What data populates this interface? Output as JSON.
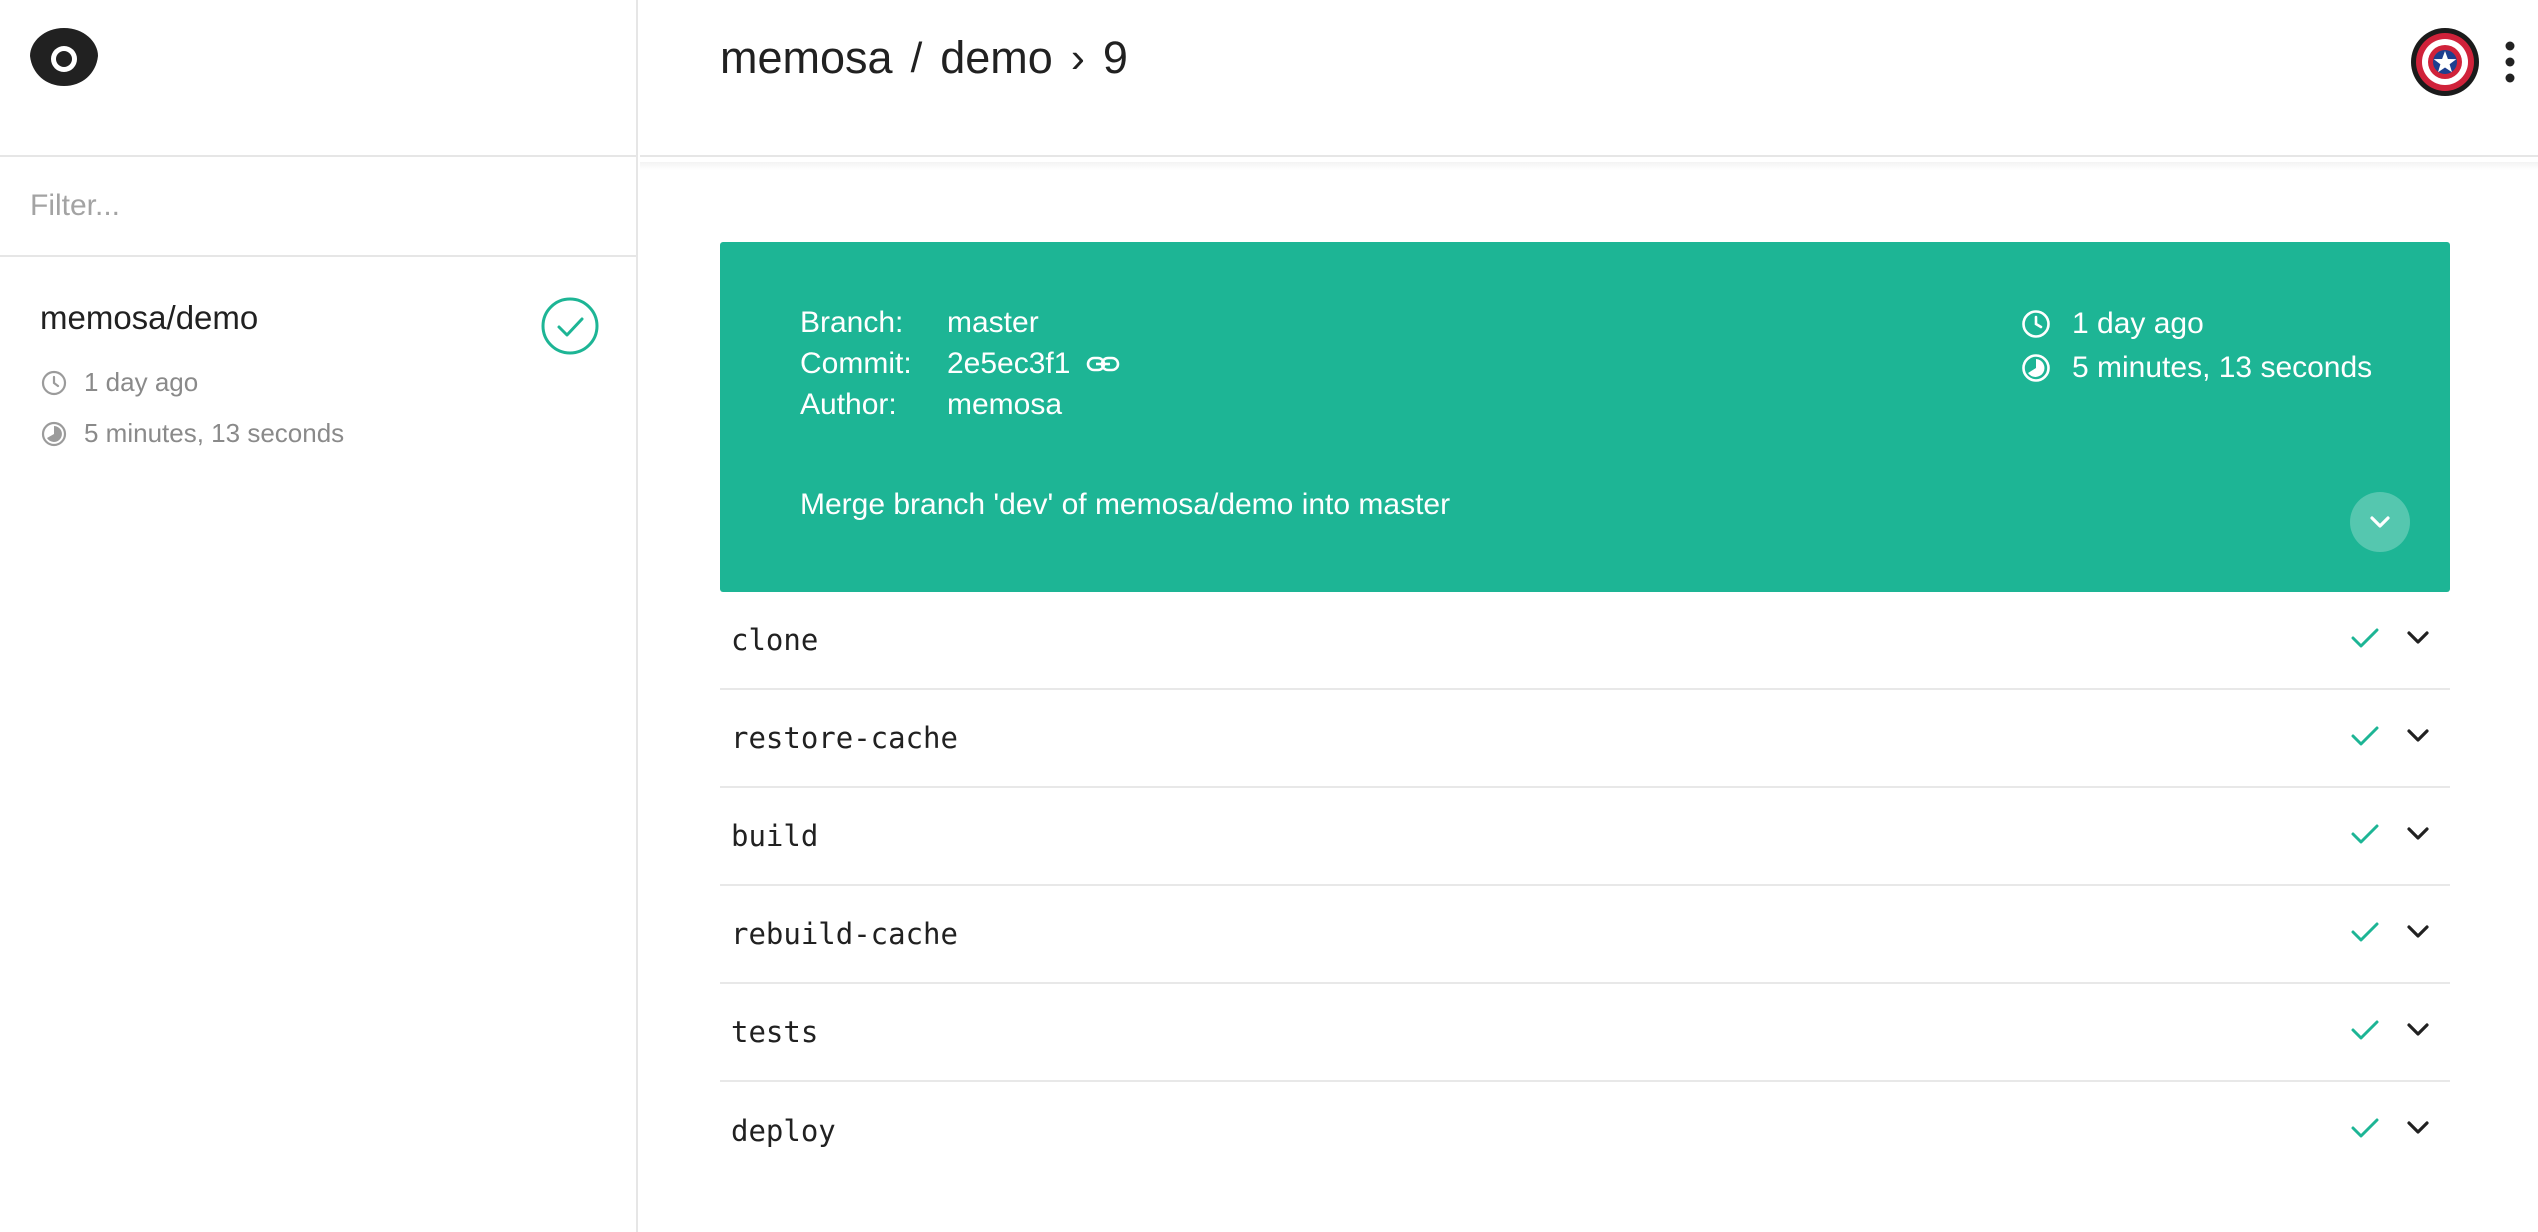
{
  "sidebar": {
    "filter_placeholder": "Filter...",
    "repos": [
      {
        "name": "memosa/demo",
        "time_ago": "1 day ago",
        "duration": "5 minutes, 13 seconds",
        "status": "success"
      }
    ]
  },
  "header": {
    "owner": "memosa",
    "slash": "/",
    "repo": "demo",
    "separator": "›",
    "build_number": "9"
  },
  "build": {
    "branch_label": "Branch:",
    "branch": "master",
    "commit_label": "Commit:",
    "commit": "2e5ec3f1",
    "author_label": "Author:",
    "author": "memosa",
    "time_ago": "1 day ago",
    "duration": "5 minutes, 13 seconds",
    "message": "Merge branch 'dev' of memosa/demo into master",
    "color": "#1db595"
  },
  "steps": [
    {
      "name": "clone",
      "status": "success"
    },
    {
      "name": "restore-cache",
      "status": "success"
    },
    {
      "name": "build",
      "status": "success"
    },
    {
      "name": "rebuild-cache",
      "status": "success"
    },
    {
      "name": "tests",
      "status": "success"
    },
    {
      "name": "deploy",
      "status": "success"
    }
  ],
  "icons": {
    "logo": "drone-logo-icon",
    "clock": "clock-icon",
    "duration": "timer-icon",
    "link": "link-icon",
    "check": "check-icon",
    "chevron": "chevron-down-icon",
    "avatar": "captain-shield-avatar",
    "menu": "more-vert-icon"
  },
  "colors": {
    "accent": "#1db595",
    "divider": "#e6e6e6",
    "muted_text": "#8a8a8a"
  }
}
